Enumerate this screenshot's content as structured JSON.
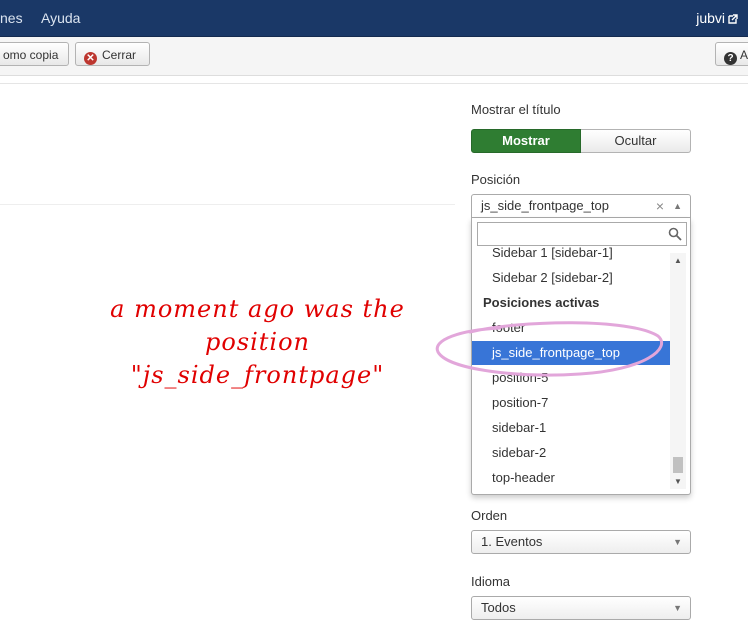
{
  "navbar": {
    "items": [
      "nes",
      "Ayuda"
    ],
    "user": "jubvi"
  },
  "toolbar": {
    "save_copy_label": "omo copia",
    "close_label": "Cerrar",
    "help_label": "A"
  },
  "panel": {
    "show_title_label": "Mostrar el título",
    "toggle": {
      "on": "Mostrar",
      "off": "Ocultar",
      "selected": "Mostrar"
    },
    "position_label": "Posición",
    "position_value": "js_side_frontpage_top",
    "dropdown": {
      "search_value": "",
      "options": [
        {
          "text": "Sidebar 1 [sidebar-1]",
          "kind": "option"
        },
        {
          "text": "Sidebar 2 [sidebar-2]",
          "kind": "option"
        },
        {
          "text": "Posiciones activas",
          "kind": "group"
        },
        {
          "text": "footer",
          "kind": "option"
        },
        {
          "text": "js_side_frontpage_top",
          "kind": "option",
          "highlighted": true
        },
        {
          "text": "position-5",
          "kind": "option"
        },
        {
          "text": "position-7",
          "kind": "option"
        },
        {
          "text": "sidebar-1",
          "kind": "option"
        },
        {
          "text": "sidebar-2",
          "kind": "option"
        },
        {
          "text": "top-header",
          "kind": "option"
        }
      ]
    },
    "order_label": "Orden",
    "order_value": "1. Eventos",
    "language_label": "Idioma",
    "language_value": "Todos"
  },
  "annotation": {
    "line1": "a moment ago was the",
    "line2": "position",
    "line3": "\"js_side_frontpage\""
  },
  "colors": {
    "navbar": "#1a3867",
    "toggle_on": "#2f7d32",
    "highlight": "#3875d7",
    "annotation": "#e00000",
    "annotation_ellipse": "#e2a6da"
  }
}
